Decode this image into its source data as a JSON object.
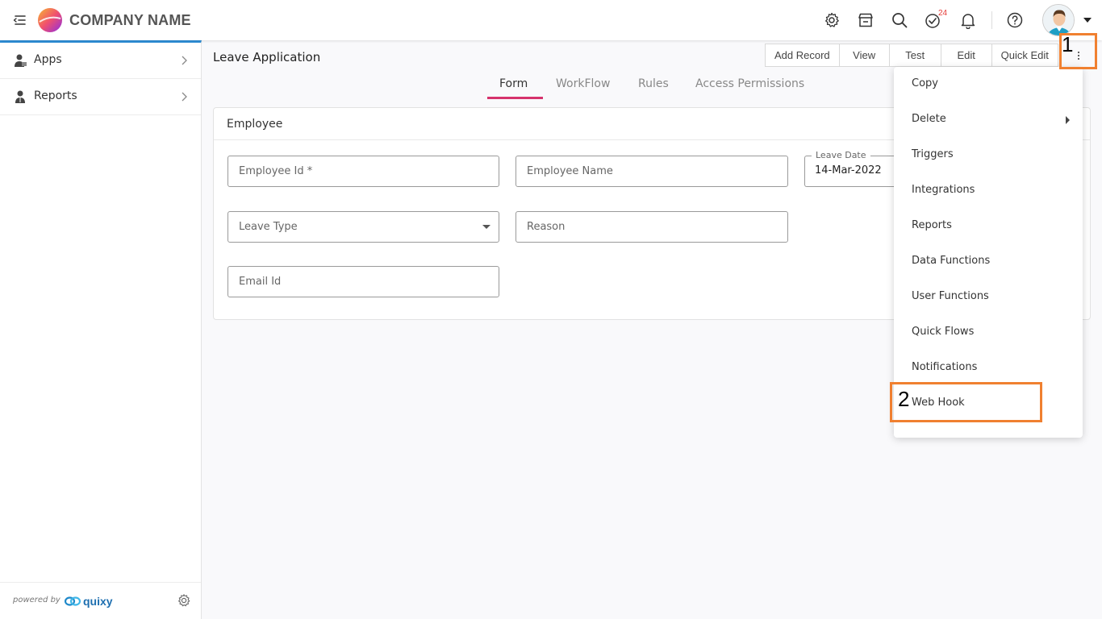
{
  "header": {
    "company_name": "COMPANY NAME",
    "tasks_badge": "24",
    "icons": [
      "menu-collapse-icon",
      "settings-gear-icon",
      "store-icon",
      "search-icon",
      "tasks-check-icon",
      "notification-bell-icon",
      "help-icon"
    ]
  },
  "sidebar": {
    "items": [
      {
        "label": "Apps",
        "icon": "apps-user-icon"
      },
      {
        "label": "Reports",
        "icon": "reports-user-icon"
      }
    ],
    "footer": {
      "powered_by": "powered by",
      "brand": "quixy"
    }
  },
  "page": {
    "title": "Leave Application"
  },
  "actions": [
    {
      "label": "Add Record"
    },
    {
      "label": "View"
    },
    {
      "label": "Test"
    },
    {
      "label": "Edit"
    },
    {
      "label": "Quick Edit"
    }
  ],
  "tabs": [
    {
      "label": "Form",
      "active": true
    },
    {
      "label": "WorkFlow",
      "active": false
    },
    {
      "label": "Rules",
      "active": false
    },
    {
      "label": "Access Permissions",
      "active": false
    }
  ],
  "form": {
    "section_title": "Employee",
    "fields": {
      "employee_id": {
        "placeholder": "Employee Id *"
      },
      "employee_name": {
        "placeholder": "Employee Name"
      },
      "leave_date": {
        "label": "Leave Date",
        "value": "14-Mar-2022"
      },
      "leave_type": {
        "placeholder": "Leave Type"
      },
      "reason": {
        "placeholder": "Reason"
      },
      "email_id": {
        "placeholder": "Email Id"
      }
    }
  },
  "more_menu": {
    "items": [
      {
        "label": "Copy"
      },
      {
        "label": "Delete",
        "has_submenu": true
      },
      {
        "label": "Triggers"
      },
      {
        "label": "Integrations"
      },
      {
        "label": "Reports"
      },
      {
        "label": "Data Functions"
      },
      {
        "label": "User Functions"
      },
      {
        "label": "Quick Flows"
      },
      {
        "label": "Notifications"
      },
      {
        "label": "Web Hook"
      }
    ]
  },
  "callouts": [
    {
      "number": "1",
      "target": "more-options-button"
    },
    {
      "number": "2",
      "target": "menu-item-web-hook"
    }
  ],
  "colors": {
    "accent": "#d6336c",
    "sidebar_top_border": "#2f8fd8",
    "callout": "#f08030",
    "badge": "#e53935"
  }
}
